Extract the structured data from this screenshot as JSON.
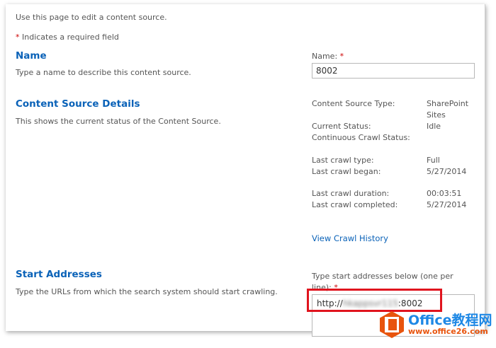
{
  "intro": "Use this page to edit a content source.",
  "required_note": {
    "star": "*",
    "text": " Indicates a required field"
  },
  "name_section": {
    "title": "Name",
    "description": "Type a name to describe this content source.",
    "field_label": "Name:",
    "field_star": "*",
    "field_value": "8002"
  },
  "details_section": {
    "title": "Content Source Details",
    "description": "This shows the current status of the Content Source.",
    "rows": [
      {
        "label": "Content Source Type:",
        "value": "SharePoint"
      },
      {
        "label": "",
        "value": "Sites"
      },
      {
        "label": "Current Status:",
        "value": "Idle"
      },
      {
        "label": "Continuous Crawl Status:",
        "value": ""
      },
      {
        "label": "Last crawl type:",
        "value": "Full"
      },
      {
        "label": "Last crawl began:",
        "value": "5/27/2014"
      },
      {
        "label": "Last crawl duration:",
        "value": "00:03:51"
      },
      {
        "label": "Last crawl completed:",
        "value": "5/27/2014"
      }
    ],
    "history_link": "View Crawl History"
  },
  "start_section": {
    "title": "Start Addresses",
    "description": "Type the URLs from which the search system should start crawling.",
    "field_label_1": "Type start addresses below (one per",
    "field_label_2": "line):",
    "field_star": "*",
    "url_prefix": "http://",
    "url_blurred": "hkappsvr115",
    "url_suffix": ":8002"
  },
  "watermark": {
    "brand": "Office教程网",
    "site": "www.office26.com"
  },
  "colors": {
    "heading": "#0a62b8",
    "highlight": "#e0141e",
    "logo": "#e8540d"
  }
}
